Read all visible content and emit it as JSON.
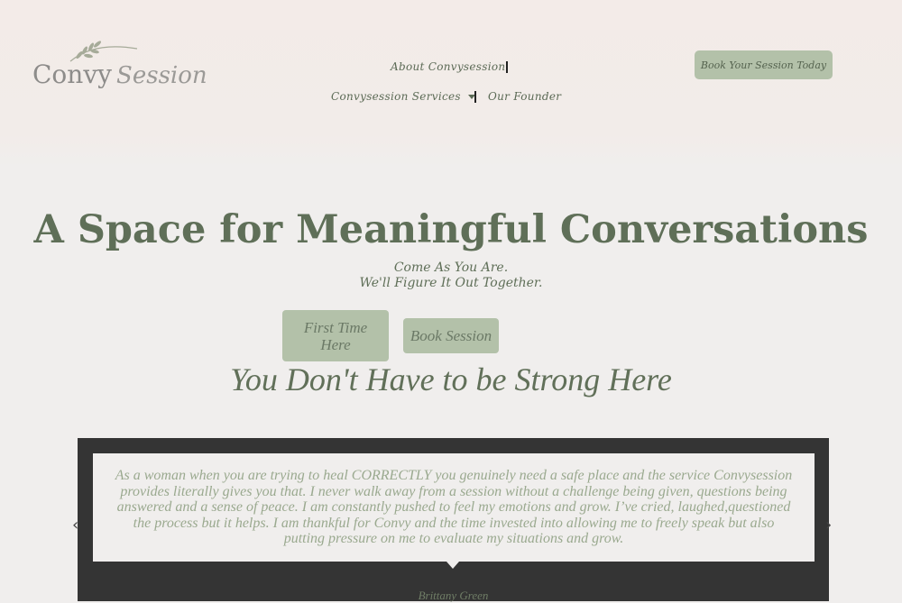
{
  "header": {
    "logo": {
      "convy": "Convy",
      "session": "Session"
    },
    "nav": {
      "about": "About Convysession",
      "services": "Convysession Services",
      "founder": "Our Founder"
    },
    "cta": "Book Your Session Today"
  },
  "hero": {
    "title": "A Space for Meaningful Conversations",
    "subtitle_1": "Come As You Are.",
    "subtitle_2": "We'll Figure It Out Together.",
    "first_time": "First Time Here",
    "book": "Book Session"
  },
  "section": {
    "heading": "You Don't Have to be Strong Here"
  },
  "testimonial": {
    "quote": "As a woman when you are trying to heal CORRECTLY you genuinely need a safe place and the service Convysession provides literally gives you that. I never walk away from a session without a challenge being given, questions being answered and a sense of peace. I am constantly pushed to feel my emotions and grow. I’ve cried, laughed,questioned the process but it helps. I am thankful for Convy and the time invested into allowing me to freely speak but also putting pressure on me to evaluate my situations and grow.",
    "author": "Brittany Green",
    "prev": "‹",
    "next": "›"
  },
  "colors": {
    "accent": "#b3c1a9",
    "text_green": "#5f6f58",
    "dark_panel": "#343434",
    "background": "#f0eeed"
  }
}
